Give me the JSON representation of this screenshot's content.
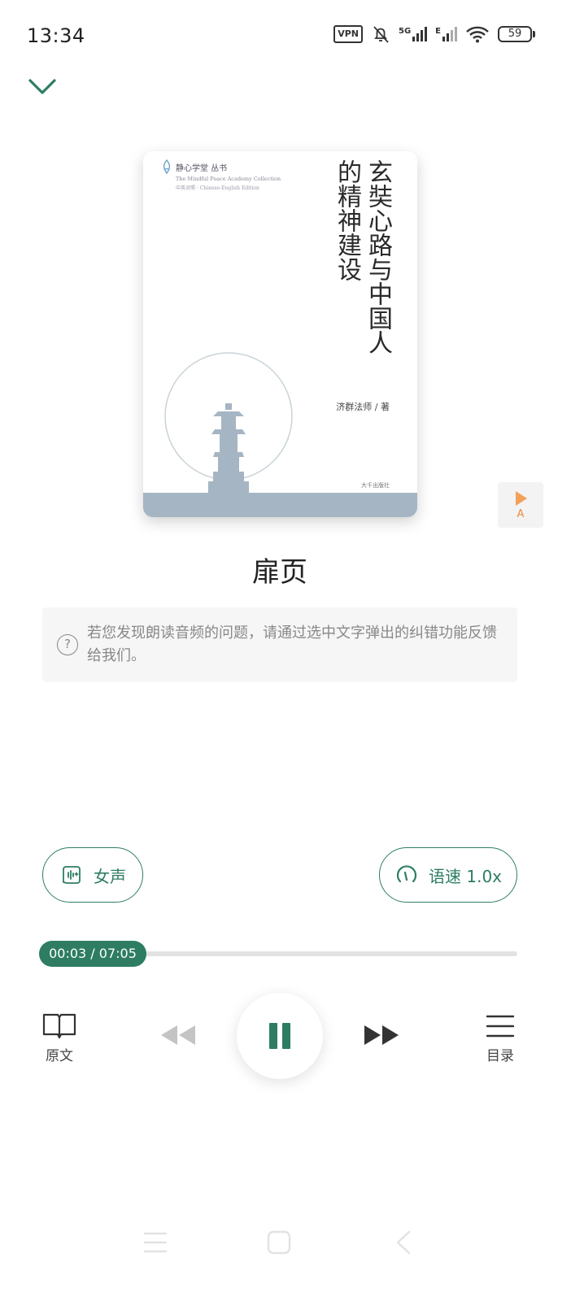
{
  "status_bar": {
    "time": "13:34",
    "vpn_label": "VPN",
    "network_label": "5G",
    "network_label_2": "E",
    "battery_level": "59",
    "icons": [
      "vpn-icon",
      "bell-off-icon",
      "signal-5g-icon",
      "signal-e-icon",
      "wifi-icon",
      "battery-icon"
    ]
  },
  "header": {
    "collapse_icon": "chevron-down-icon"
  },
  "cover": {
    "series_cn": "静心学堂 丛书",
    "series_en": "The Mindful Peace Academy Collection",
    "series_edition": "中英对照 · Chinese-English Edition",
    "title": "玄奘心路与中国人的精神建设",
    "author": "济群法师 / 著",
    "publisher": "大千出版社"
  },
  "float_button": {
    "label": "A"
  },
  "chapter": {
    "title": "扉页"
  },
  "notice": {
    "icon": "question-circle-icon",
    "text": "若您发现朗读音频的问题，请通过选中文字弹出的纠错功能反馈给我们。"
  },
  "voice": {
    "label": "女声",
    "icon": "voice-wave-icon"
  },
  "speed": {
    "label": "语速 1.0x",
    "icon": "speedometer-icon"
  },
  "progress": {
    "time_label": "00:03 / 07:05",
    "fraction": 0.007
  },
  "controls": {
    "original_label": "原文",
    "toc_label": "目录",
    "icons": [
      "book-open-icon",
      "rewind-icon",
      "pause-icon",
      "fast-forward-icon",
      "menu-list-icon"
    ]
  },
  "colors": {
    "accent": "#2e7d63",
    "cover_band": "#a5b5c3",
    "float_accent": "#f5a05a"
  }
}
